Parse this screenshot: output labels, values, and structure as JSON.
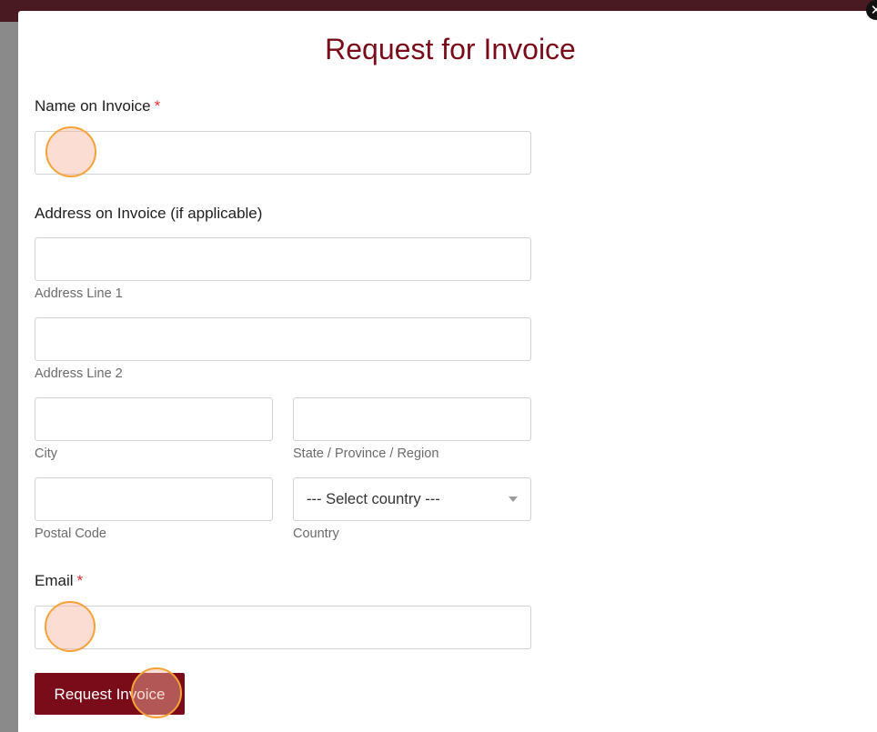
{
  "modal": {
    "title": "Request for Invoice",
    "close_icon": "close-icon"
  },
  "form": {
    "name": {
      "label": "Name on Invoice",
      "required_mark": "*",
      "value": ""
    },
    "address": {
      "section_label": "Address on Invoice (if applicable)",
      "line1_hint": "Address Line 1",
      "line2_hint": "Address Line 2",
      "city_hint": "City",
      "state_hint": "State / Province / Region",
      "postal_hint": "Postal Code",
      "country_hint": "Country",
      "country_selected": "--- Select country ---"
    },
    "email": {
      "label": "Email",
      "required_mark": "*",
      "value": ""
    },
    "submit_label": "Request Invoice"
  },
  "colors": {
    "accent": "#7a0c1a",
    "required": "#d32f2f",
    "marker_ring": "#f6a237"
  }
}
